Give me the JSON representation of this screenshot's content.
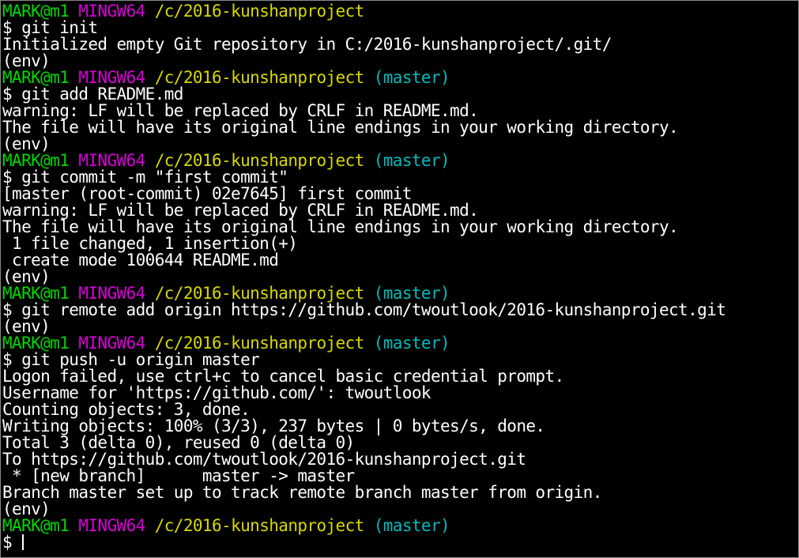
{
  "colors": {
    "background": "#000000",
    "user_host": "#00d800",
    "system": "#d800d8",
    "path": "#d8d800",
    "branch": "#00bcbc",
    "text": "#ffffff"
  },
  "prompt": {
    "user_host": "MARK@m1",
    "system": "MINGW64",
    "path": "/c/2016-kunshanproject",
    "branch": "(master)",
    "symbol": "$ "
  },
  "lines": [
    {
      "type": "prompt",
      "branch": false
    },
    {
      "type": "cmd",
      "text": "$ git init"
    },
    {
      "type": "out",
      "text": "Initialized empty Git repository in C:/2016-kunshanproject/.git/"
    },
    {
      "type": "out",
      "text": "(env)"
    },
    {
      "type": "prompt",
      "branch": true
    },
    {
      "type": "cmd",
      "text": "$ git add README.md"
    },
    {
      "type": "out",
      "text": "warning: LF will be replaced by CRLF in README.md."
    },
    {
      "type": "out",
      "text": "The file will have its original line endings in your working directory."
    },
    {
      "type": "out",
      "text": "(env)"
    },
    {
      "type": "prompt",
      "branch": true
    },
    {
      "type": "cmd",
      "text": "$ git commit -m \"first commit\""
    },
    {
      "type": "out",
      "text": "[master (root-commit) 02e7645] first commit"
    },
    {
      "type": "out",
      "text": "warning: LF will be replaced by CRLF in README.md."
    },
    {
      "type": "out",
      "text": "The file will have its original line endings in your working directory."
    },
    {
      "type": "out",
      "text": " 1 file changed, 1 insertion(+)"
    },
    {
      "type": "out",
      "text": " create mode 100644 README.md"
    },
    {
      "type": "out",
      "text": "(env)"
    },
    {
      "type": "prompt",
      "branch": true
    },
    {
      "type": "cmd",
      "text": "$ git remote add origin https://github.com/twoutlook/2016-kunshanproject.git"
    },
    {
      "type": "out",
      "text": "(env)"
    },
    {
      "type": "prompt",
      "branch": true
    },
    {
      "type": "cmd",
      "text": "$ git push -u origin master"
    },
    {
      "type": "out",
      "text": "Logon failed, use ctrl+c to cancel basic credential prompt."
    },
    {
      "type": "out",
      "text": "Username for 'https://github.com/': twoutlook"
    },
    {
      "type": "out",
      "text": "Counting objects: 3, done."
    },
    {
      "type": "out",
      "text": "Writing objects: 100% (3/3), 237 bytes | 0 bytes/s, done."
    },
    {
      "type": "out",
      "text": "Total 3 (delta 0), reused 0 (delta 0)"
    },
    {
      "type": "out",
      "text": "To https://github.com/twoutlook/2016-kunshanproject.git"
    },
    {
      "type": "out",
      "text": " * [new branch]      master -> master"
    },
    {
      "type": "out",
      "text": "Branch master set up to track remote branch master from origin."
    },
    {
      "type": "out",
      "text": "(env)"
    },
    {
      "type": "prompt",
      "branch": true
    },
    {
      "type": "input",
      "text": "$ "
    }
  ]
}
